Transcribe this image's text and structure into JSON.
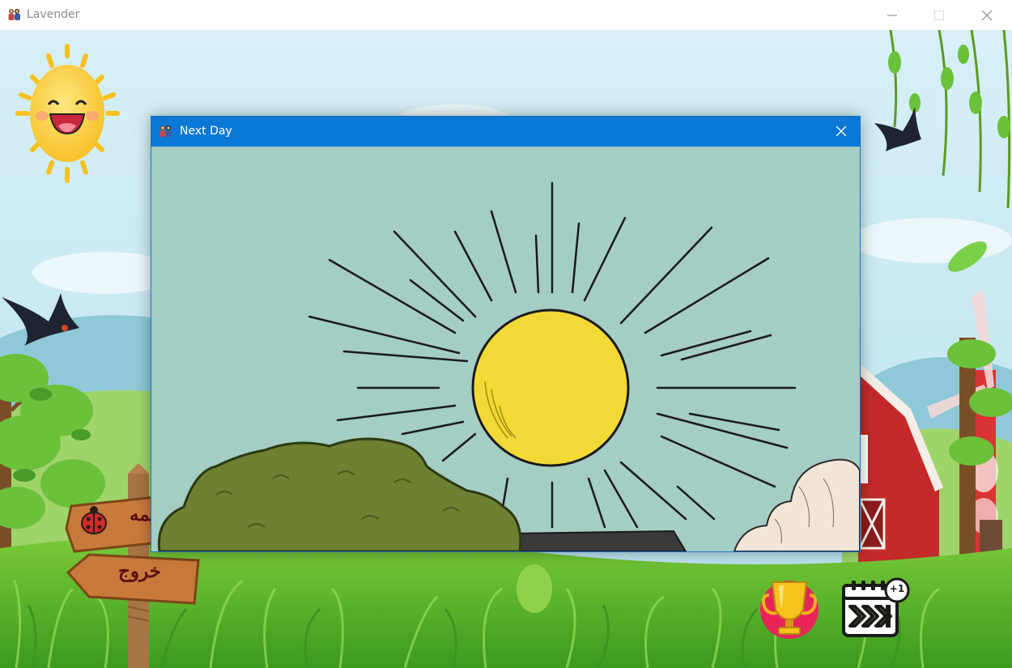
{
  "app": {
    "title": "Lavender"
  },
  "dialog": {
    "title": "Next Day"
  },
  "menu": {
    "sign_top_label": "همه",
    "sign_exit_label": "خروج"
  },
  "icons": {
    "app": "family-icon",
    "trophy": "trophy-icon",
    "next_day": "calendar-skip-plus-one-icon",
    "next_day_badge": "+1"
  },
  "colors": {
    "sky": "#bfe6f0",
    "grass": "#5cb82d",
    "dialog_titlebar": "#0a78d4",
    "dialog_bg": "#a4cdc4",
    "sun": "#f2d935",
    "barn": "#c42a2a",
    "sign_wood": "#c87a3c"
  }
}
